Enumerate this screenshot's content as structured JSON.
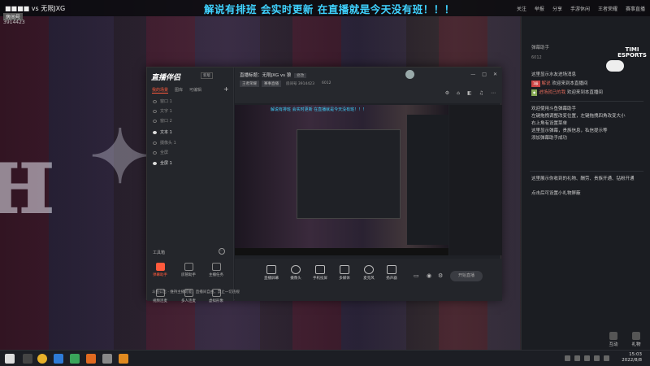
{
  "stream": {
    "match_title": "■■■■ vs 无限JXG",
    "viewer_badge": "房间号",
    "room_id": "3914423",
    "broadcast_text": "解说有排班 会实时更新 在直播就是今天没有班！！！",
    "top_actions": [
      "关注",
      "举报",
      "分享",
      "手游休闲",
      "王者荣耀",
      "赛事直播"
    ]
  },
  "chat": {
    "room_label": "弹幕助手",
    "room_sub": "6012",
    "brand": "TIMI ESPORTS",
    "messages": [
      {
        "text": "这里显示水友进场消息"
      },
      {
        "tag": "1级",
        "name": "解说",
        "text": "欢迎来到本直播间"
      },
      {
        "tag2": "",
        "name": "进场就已的我",
        "text": "欢迎来到本直播间"
      },
      {
        "text": "欢迎使用斗鱼弹幕助手"
      },
      {
        "text": "左键拖拽调整改变位置，左键拖拽四角改变大小"
      },
      {
        "text": "右上角有设置菜单"
      },
      {
        "text": "这里显示弹幕，贵族信息，私信提示等"
      },
      {
        "text": "添加弹幕助手成功"
      },
      {
        "text": "这里展示你收到的礼物、酬劳、贵族开通、钻粉开通"
      },
      {
        "text": "点击后可设置小礼物屏蔽"
      }
    ],
    "buttons": [
      "互动",
      "礼物"
    ]
  },
  "app": {
    "name": "直播伴侣",
    "version": "新版",
    "left_tabs": [
      "我的场景",
      "图库",
      "可编辑"
    ],
    "scenes": [
      {
        "label": "窗口 1",
        "on": false
      },
      {
        "label": "文字 1",
        "on": false
      },
      {
        "label": "窗口 2",
        "on": false
      },
      {
        "label": "文本 1",
        "on": true
      },
      {
        "label": "摄像头 1",
        "on": false
      },
      {
        "label": "全屏",
        "on": false
      },
      {
        "label": "全屏 1",
        "on": true
      }
    ],
    "tools_header": "工具箱",
    "tools": [
      "弹幕助手",
      "房管助手",
      "主播任务",
      "视频连麦",
      "多人连麦",
      "虚拟形象",
      "虚拟直播",
      "弹幕墙",
      "歌词显示",
      "游戏助手",
      "更多"
    ],
    "footer": "斗鱼公告 · 维持主播可能，直播间自由，禁止一切违规",
    "header": {
      "title": "直播标题：无限JXG vs 狼",
      "edit": "修改",
      "category": "王者荣耀",
      "id_label": "房间号 3914423",
      "extra": "赛事直播",
      "fans": "6012",
      "window_controls": [
        "—",
        "□",
        "✕"
      ],
      "tools": [
        "⚙",
        "⌂",
        "◧",
        "♫",
        "⋯"
      ]
    },
    "preview_banner": "解说有排班 会实时更新 在直播就是今天没有班！！！",
    "bottom": [
      "直播屏幕",
      "摄像头",
      "手机投屏",
      "多媒体",
      "麦克风",
      "扬声器"
    ],
    "go_live": "开始直播"
  },
  "taskbar": {
    "time": "15:03",
    "date": "2022/8/8"
  }
}
